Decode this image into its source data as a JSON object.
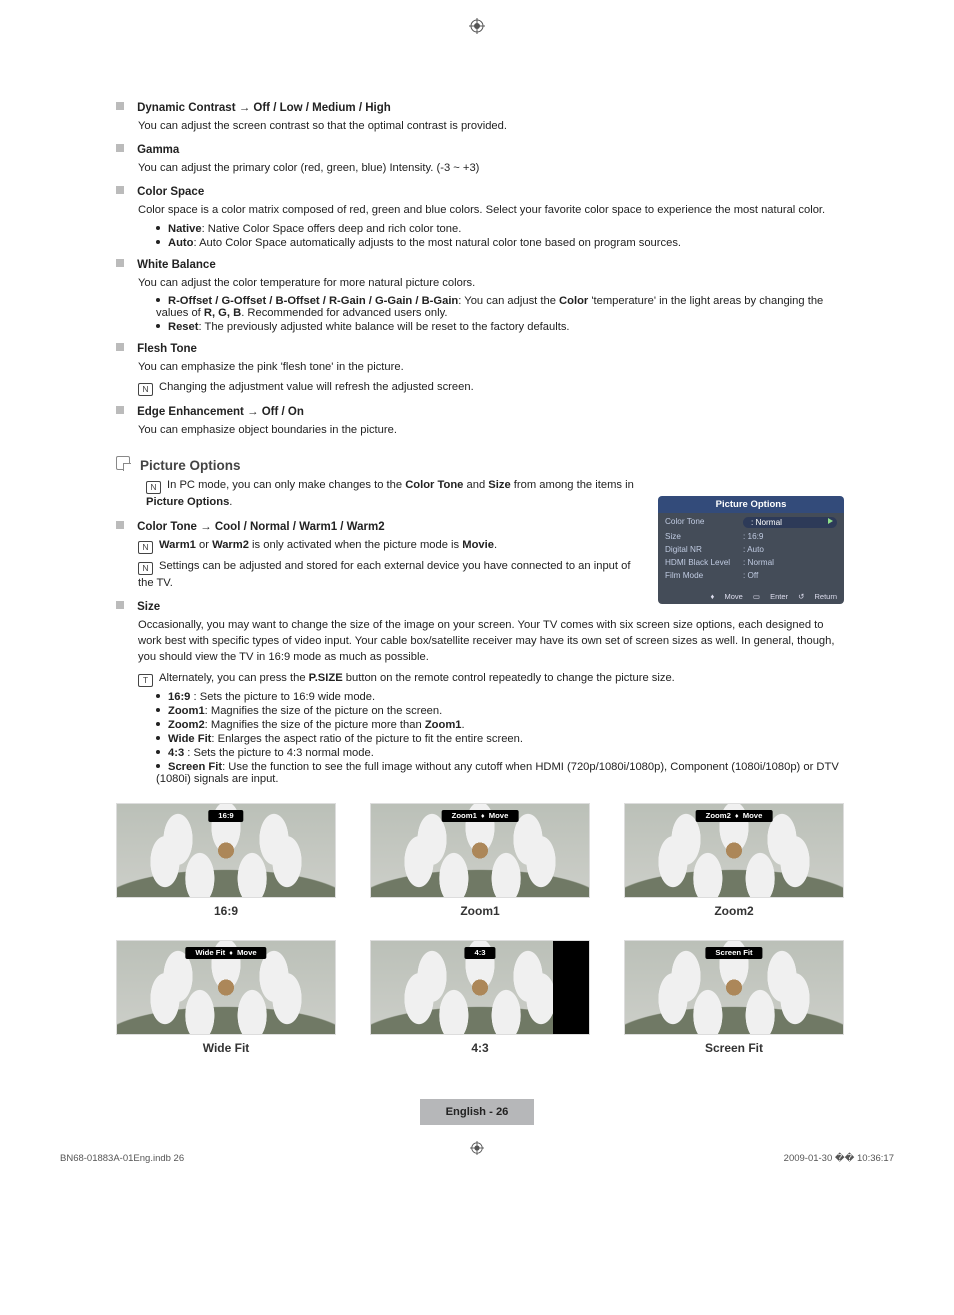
{
  "sections": {
    "dynContrast": {
      "title": "Dynamic Contrast → Off / Low / Medium / High",
      "desc": "You can adjust the screen contrast so that the optimal contrast is provided."
    },
    "gamma": {
      "title": "Gamma",
      "desc": "You can adjust the primary color (red, green, blue) Intensity. (-3 ~ +3)"
    },
    "colorSpace": {
      "title": "Color Space",
      "desc": "Color space is a color matrix composed of red, green and blue colors. Select your favorite color space to experience the most natural color.",
      "b1_h": "Native",
      "b1": ": Native Color Space offers deep and rich color tone.",
      "b2_h": "Auto",
      "b2": ": Auto Color Space automatically adjusts to the most natural color tone based on program sources."
    },
    "whiteBal": {
      "title": "White Balance",
      "desc": "You can adjust the color temperature for more natural picture colors.",
      "b1_h": "R-Offset / G-Offset / B-Offset / R-Gain / G-Gain / B-Gain",
      "b1a": ": You can adjust the ",
      "b1b": "Color",
      "b1c": " 'temperature' in the light areas by changing the values of ",
      "b1d": "R, G, B",
      "b1e": ". Recommended for advanced users only.",
      "b2_h": "Reset",
      "b2": ": The previously adjusted white balance will be reset to the factory defaults."
    },
    "flesh": {
      "title": "Flesh Tone",
      "desc": "You can emphasize the pink 'flesh tone' in the picture.",
      "note": "Changing the adjustment value will refresh the adjusted screen."
    },
    "edge": {
      "title": "Edge Enhancement → Off / On",
      "desc": "You can emphasize object boundaries in the picture."
    },
    "picOpt": {
      "title": "Picture Options",
      "note_a": "In PC mode, you can only make changes to the ",
      "note_b": "Color Tone",
      "note_c": " and ",
      "note_d": "Size",
      "note_e": " from among the items in ",
      "note_f": "Picture Options",
      "note_g": "."
    },
    "colorTone": {
      "title": "Color Tone → Cool / Normal / Warm1 / Warm2",
      "n1_a": "Warm1",
      "n1_b": " or ",
      "n1_c": "Warm2",
      "n1_d": " is only activated when the picture mode is ",
      "n1_e": "Movie",
      "n1_f": ".",
      "n2": "Settings can be adjusted and stored for each external device you have connected to an input of the TV."
    },
    "size": {
      "title": "Size",
      "desc": "Occasionally, you may want to change the size of the image on your screen. Your TV comes with six screen size options, each designed to work best with specific types of video input. Your cable box/satellite receiver may have its own set of screen sizes as well. In general, though, you should view the TV in 16:9 mode as much as possible.",
      "tip_a": "Alternately, you can press the ",
      "tip_b": "P.SIZE",
      "tip_c": " button on the remote control repeatedly to change the picture size.",
      "b1_h": "16:9",
      "b1": " : Sets the picture to 16:9 wide mode.",
      "b2_h": "Zoom1",
      "b2": ": Magnifies the size of the picture on the screen.",
      "b3_h": "Zoom2",
      "b3_a": ": Magnifies the size of the picture more than ",
      "b3_b": "Zoom1",
      "b3_c": ".",
      "b4_h": "Wide Fit",
      "b4": ": Enlarges the aspect ratio of the picture to fit the entire screen.",
      "b5_h": "4:3",
      "b5": " : Sets the picture to 4:3 normal mode.",
      "b6_h": "Screen Fit",
      "b6": ": Use the function to see the full image without any cutoff when HDMI (720p/1080i/1080p), Component (1080i/1080p) or DTV (1080i) signals are input."
    }
  },
  "panel": {
    "title": "Picture Options",
    "rows": [
      {
        "k": "Color Tone",
        "v": ": Normal",
        "hl": true
      },
      {
        "k": "Size",
        "v": ": 16:9"
      },
      {
        "k": "Digital NR",
        "v": ": Auto"
      },
      {
        "k": "HDMI Black Level",
        "v": ": Normal"
      },
      {
        "k": "Film Mode",
        "v": ": Off"
      }
    ],
    "foot": {
      "move": "Move",
      "enter": "Enter",
      "return": "Return"
    }
  },
  "thumbs": [
    {
      "banner": "16:9",
      "caption": "16:9",
      "move": false,
      "pillarbox": false
    },
    {
      "banner": "Zoom1",
      "caption": "Zoom1",
      "move": true,
      "pillarbox": false
    },
    {
      "banner": "Zoom2",
      "caption": "Zoom2",
      "move": true,
      "pillarbox": false
    },
    {
      "banner": "Wide Fit",
      "caption": "Wide Fit",
      "move": true,
      "pillarbox": false
    },
    {
      "banner": "4:3",
      "caption": "4:3",
      "move": false,
      "pillarbox": true
    },
    {
      "banner": "Screen Fit",
      "caption": "Screen Fit",
      "move": false,
      "pillarbox": false
    }
  ],
  "footer": {
    "page": "English - 26",
    "file": "BN68-01883A-01Eng.indb   26",
    "date": "2009-01-30   �� 10:36:17"
  },
  "moveWord": "Move"
}
